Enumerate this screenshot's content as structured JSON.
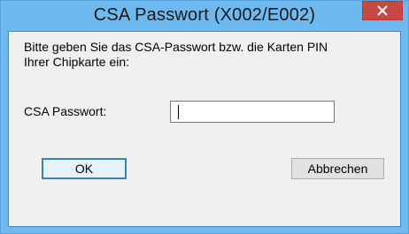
{
  "window": {
    "title": "CSA Passwort (X002/E002)"
  },
  "dialog": {
    "prompt": "Bitte geben Sie das CSA-Passwort bzw. die Karten PIN Ihrer Chipkarte ein:",
    "field_label": "CSA Passwort:",
    "password_value": ""
  },
  "buttons": {
    "ok_label": "OK",
    "cancel_label": "Abbrechen",
    "close_icon": "close-icon"
  },
  "colors": {
    "titlebar": "#6eb9ef",
    "close_button": "#c74a42",
    "client_background": "#f0f0f0"
  }
}
